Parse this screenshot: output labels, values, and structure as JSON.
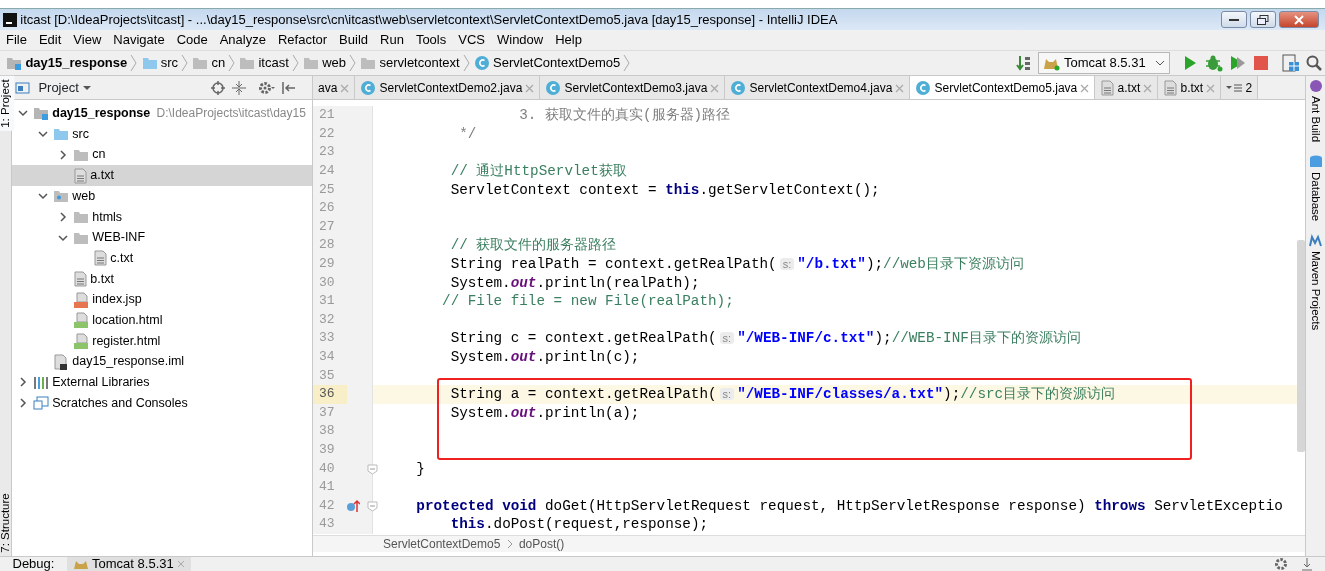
{
  "window": {
    "title": "itcast [D:\\IdeaProjects\\itcast] - ...\\day15_response\\src\\cn\\itcast\\web\\servletcontext\\ServletContextDemo5.java [day15_response] - IntelliJ IDEA"
  },
  "menu": [
    "File",
    "Edit",
    "View",
    "Navigate",
    "Code",
    "Analyze",
    "Refactor",
    "Build",
    "Run",
    "Tools",
    "VCS",
    "Window",
    "Help"
  ],
  "breadcrumbs": [
    {
      "label": "day15_response",
      "kind": "module"
    },
    {
      "label": "src",
      "kind": "folder-src"
    },
    {
      "label": "cn",
      "kind": "folder"
    },
    {
      "label": "itcast",
      "kind": "folder"
    },
    {
      "label": "web",
      "kind": "folder"
    },
    {
      "label": "servletcontext",
      "kind": "folder"
    },
    {
      "label": "ServletContextDemo5",
      "kind": "class"
    }
  ],
  "run_config": {
    "label": "Tomcat 8.5.31"
  },
  "left_stripe": [
    "1: Project",
    "7: Structure"
  ],
  "right_stripe": [
    "Ant Build",
    "Database",
    "Maven Projects"
  ],
  "project": {
    "title": "Project",
    "tree": [
      {
        "label": "day15_response",
        "path": "D:\\IdeaProjects\\itcast\\day15",
        "kind": "module",
        "expanded": true,
        "selected": false,
        "children": [
          {
            "label": "src",
            "kind": "folder-src",
            "expanded": true,
            "selected": false,
            "children": [
              {
                "label": "cn",
                "kind": "folder",
                "expanded": false,
                "selected": false
              },
              {
                "label": "a.txt",
                "kind": "txt",
                "selected": true
              }
            ]
          },
          {
            "label": "web",
            "kind": "folder-web",
            "expanded": true,
            "selected": false,
            "children": [
              {
                "label": "htmls",
                "kind": "folder",
                "expanded": false,
                "selected": false
              },
              {
                "label": "WEB-INF",
                "kind": "folder",
                "expanded": true,
                "selected": false,
                "children": [
                  {
                    "label": "c.txt",
                    "kind": "txt",
                    "selected": false
                  }
                ]
              },
              {
                "label": "b.txt",
                "kind": "txt",
                "selected": false
              },
              {
                "label": "index.jsp",
                "kind": "jsp",
                "selected": false
              },
              {
                "label": "location.html",
                "kind": "html",
                "selected": false
              },
              {
                "label": "register.html",
                "kind": "html",
                "selected": false
              }
            ]
          },
          {
            "label": "day15_response.iml",
            "kind": "iml",
            "selected": false
          }
        ]
      },
      {
        "label": "External Libraries",
        "kind": "libraries",
        "expanded": false,
        "selected": false
      },
      {
        "label": "Scratches and Consoles",
        "kind": "scratches",
        "expanded": false,
        "selected": false
      }
    ]
  },
  "tabs": [
    {
      "label": "ava",
      "kind": "partial",
      "selected": false
    },
    {
      "label": "ServletContextDemo2.java",
      "kind": "class",
      "selected": false
    },
    {
      "label": "ServletContextDemo3.java",
      "kind": "class",
      "selected": false
    },
    {
      "label": "ServletContextDemo4.java",
      "kind": "class",
      "selected": false
    },
    {
      "label": "ServletContextDemo5.java",
      "kind": "class",
      "selected": true
    },
    {
      "label": "a.txt",
      "kind": "txt",
      "selected": false
    },
    {
      "label": "b.txt",
      "kind": "txt",
      "selected": false
    }
  ],
  "tab_overflow": {
    "count": "2"
  },
  "code": [
    {
      "number": "21",
      "current": false,
      "segments": [
        {
          "kind": "doc",
          "text": "                3. 获取文件的真实(服务器)路径"
        }
      ]
    },
    {
      "number": "22",
      "current": false,
      "segments": [
        {
          "kind": "doc",
          "text": "         */"
        }
      ]
    },
    {
      "number": "23",
      "current": false
    },
    {
      "number": "24",
      "current": false,
      "segments": [
        {
          "kind": "comment",
          "text": "        // 通过HttpServlet获取"
        }
      ]
    },
    {
      "number": "25",
      "current": false,
      "segments": [
        {
          "kind": "plain",
          "text": "        ServletContext context = "
        },
        {
          "kind": "keyword",
          "text": "this"
        },
        {
          "kind": "plain",
          "text": ".getServletContext();"
        }
      ]
    },
    {
      "number": "26",
      "current": false
    },
    {
      "number": "27",
      "current": false
    },
    {
      "number": "28",
      "current": false,
      "segments": [
        {
          "kind": "comment",
          "text": "        // 获取文件的服务器路径"
        }
      ]
    },
    {
      "number": "29",
      "current": false,
      "segments": [
        {
          "kind": "plain",
          "text": "        String realPath = context.getRealPath("
        },
        {
          "kind": "hint",
          "text": "s:"
        },
        {
          "kind": "string",
          "text": "\"/b.txt\""
        },
        {
          "kind": "plain",
          "text": ");"
        },
        {
          "kind": "comment",
          "text": "//web目录下资源访问"
        }
      ]
    },
    {
      "number": "30",
      "current": false,
      "segments": [
        {
          "kind": "plain",
          "text": "        System."
        },
        {
          "kind": "field",
          "text": "out"
        },
        {
          "kind": "plain",
          "text": ".println(realPath);"
        }
      ]
    },
    {
      "number": "31",
      "current": false,
      "segments": [
        {
          "kind": "comment",
          "text": "       // File file = new File(realPath);"
        }
      ]
    },
    {
      "number": "32",
      "current": false
    },
    {
      "number": "33",
      "current": false,
      "segments": [
        {
          "kind": "plain",
          "text": "        String c = context.getRealPath("
        },
        {
          "kind": "hint",
          "text": "s:"
        },
        {
          "kind": "string",
          "text": "\"/WEB-INF/c.txt\""
        },
        {
          "kind": "plain",
          "text": ");"
        },
        {
          "kind": "comment",
          "text": "//WEB-INF目录下的资源访问"
        }
      ]
    },
    {
      "number": "34",
      "current": false,
      "segments": [
        {
          "kind": "plain",
          "text": "        System."
        },
        {
          "kind": "field",
          "text": "out"
        },
        {
          "kind": "plain",
          "text": ".println(c);"
        }
      ]
    },
    {
      "number": "35",
      "current": false
    },
    {
      "number": "36",
      "current": true,
      "segments": [
        {
          "kind": "plain",
          "text": "        String a = context.getRealPath("
        },
        {
          "kind": "hint",
          "text": "s:"
        },
        {
          "kind": "string",
          "text": "\"/WEB-INF/classes/a.txt\""
        },
        {
          "kind": "plain",
          "text": ");"
        },
        {
          "kind": "comment",
          "text": "//src目录下的资源访问"
        }
      ]
    },
    {
      "number": "37",
      "current": false,
      "segments": [
        {
          "kind": "plain",
          "text": "        System."
        },
        {
          "kind": "field",
          "text": "out"
        },
        {
          "kind": "plain",
          "text": ".println(a);"
        }
      ]
    },
    {
      "number": "38",
      "current": false
    },
    {
      "number": "39",
      "current": false
    },
    {
      "number": "40",
      "current": false,
      "fold": true,
      "segments": [
        {
          "kind": "plain",
          "text": "    }"
        }
      ]
    },
    {
      "number": "41",
      "current": false
    },
    {
      "number": "42",
      "current": false,
      "fold": true,
      "override": true,
      "segments": [
        {
          "kind": "keyword",
          "text": "    protected"
        },
        {
          "kind": "keyword",
          "text": " void"
        },
        {
          "kind": "plain",
          "text": " doGet(HttpServletRequest request, HttpServletResponse response) "
        },
        {
          "kind": "keyword",
          "text": "throws"
        },
        {
          "kind": "plain",
          "text": " ServletExceptio"
        }
      ]
    },
    {
      "number": "43",
      "current": false,
      "segments": [
        {
          "kind": "keyword",
          "text": "        this"
        },
        {
          "kind": "plain",
          "text": ".doPost(request,response);"
        }
      ]
    }
  ],
  "editor_breadcrumbs": [
    "ServletContextDemo5",
    "doPost()"
  ],
  "bottom_bar": {
    "label": "Debug:",
    "tab": "Tomcat 8.5.31"
  }
}
